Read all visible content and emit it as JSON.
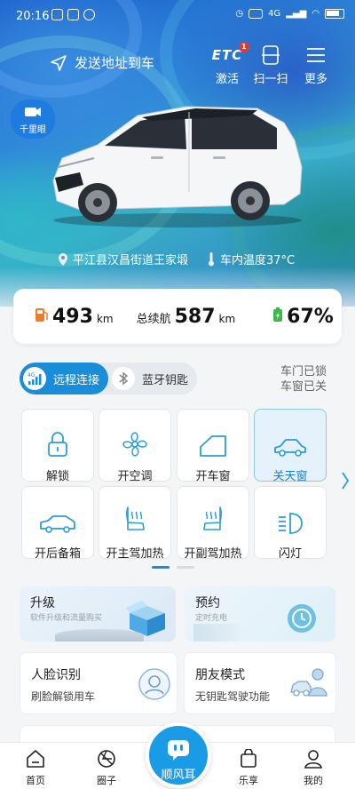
{
  "status_bar": {
    "time": "20:16",
    "net": "4G"
  },
  "header": {
    "send_address": "发送地址到车",
    "etc_label": "ETC",
    "etc_badge": "1",
    "activate": "激活",
    "scan": "扫一扫",
    "more": "更多"
  },
  "qianli": "千里眼",
  "location": {
    "address": "平江县汉昌街道王家塅",
    "cabin_temp": "车内温度37°C"
  },
  "range": {
    "fuel_value": "493",
    "fuel_unit": "km",
    "total_label": "总续航",
    "total_value": "587",
    "total_unit": "km",
    "battery_value": "67%"
  },
  "connect_tabs": {
    "remote": "远程连接",
    "bluetooth": "蓝牙钥匙",
    "net_badge": "4G"
  },
  "door_status": {
    "doors": "车门已锁",
    "windows": "车窗已关"
  },
  "controls": [
    {
      "label": "解锁"
    },
    {
      "label": "开空调"
    },
    {
      "label": "开车窗"
    },
    {
      "label": "关天窗"
    },
    {
      "label": "开后备箱"
    },
    {
      "label": "开主驾加热"
    },
    {
      "label": "开副驾加热"
    },
    {
      "label": "闪灯"
    }
  ],
  "promos": {
    "upgrade_title": "升级",
    "upgrade_sub": "软件升级和流量购买",
    "booking_title": "预约",
    "booking_sub": "定时充电"
  },
  "features": {
    "face_title": "人脸识别",
    "face_sub": "刷脸解锁用车",
    "friend_title": "朋友模式",
    "friend_sub": "无钥匙驾驶功能"
  },
  "tabbar": {
    "home": "首页",
    "circle": "圈子",
    "center": "顺风耳",
    "shop": "乐享",
    "me": "我的"
  },
  "colors": {
    "accent": "#1a8dd8",
    "fuel": "#f07c2a",
    "battery": "#3cb84c"
  }
}
